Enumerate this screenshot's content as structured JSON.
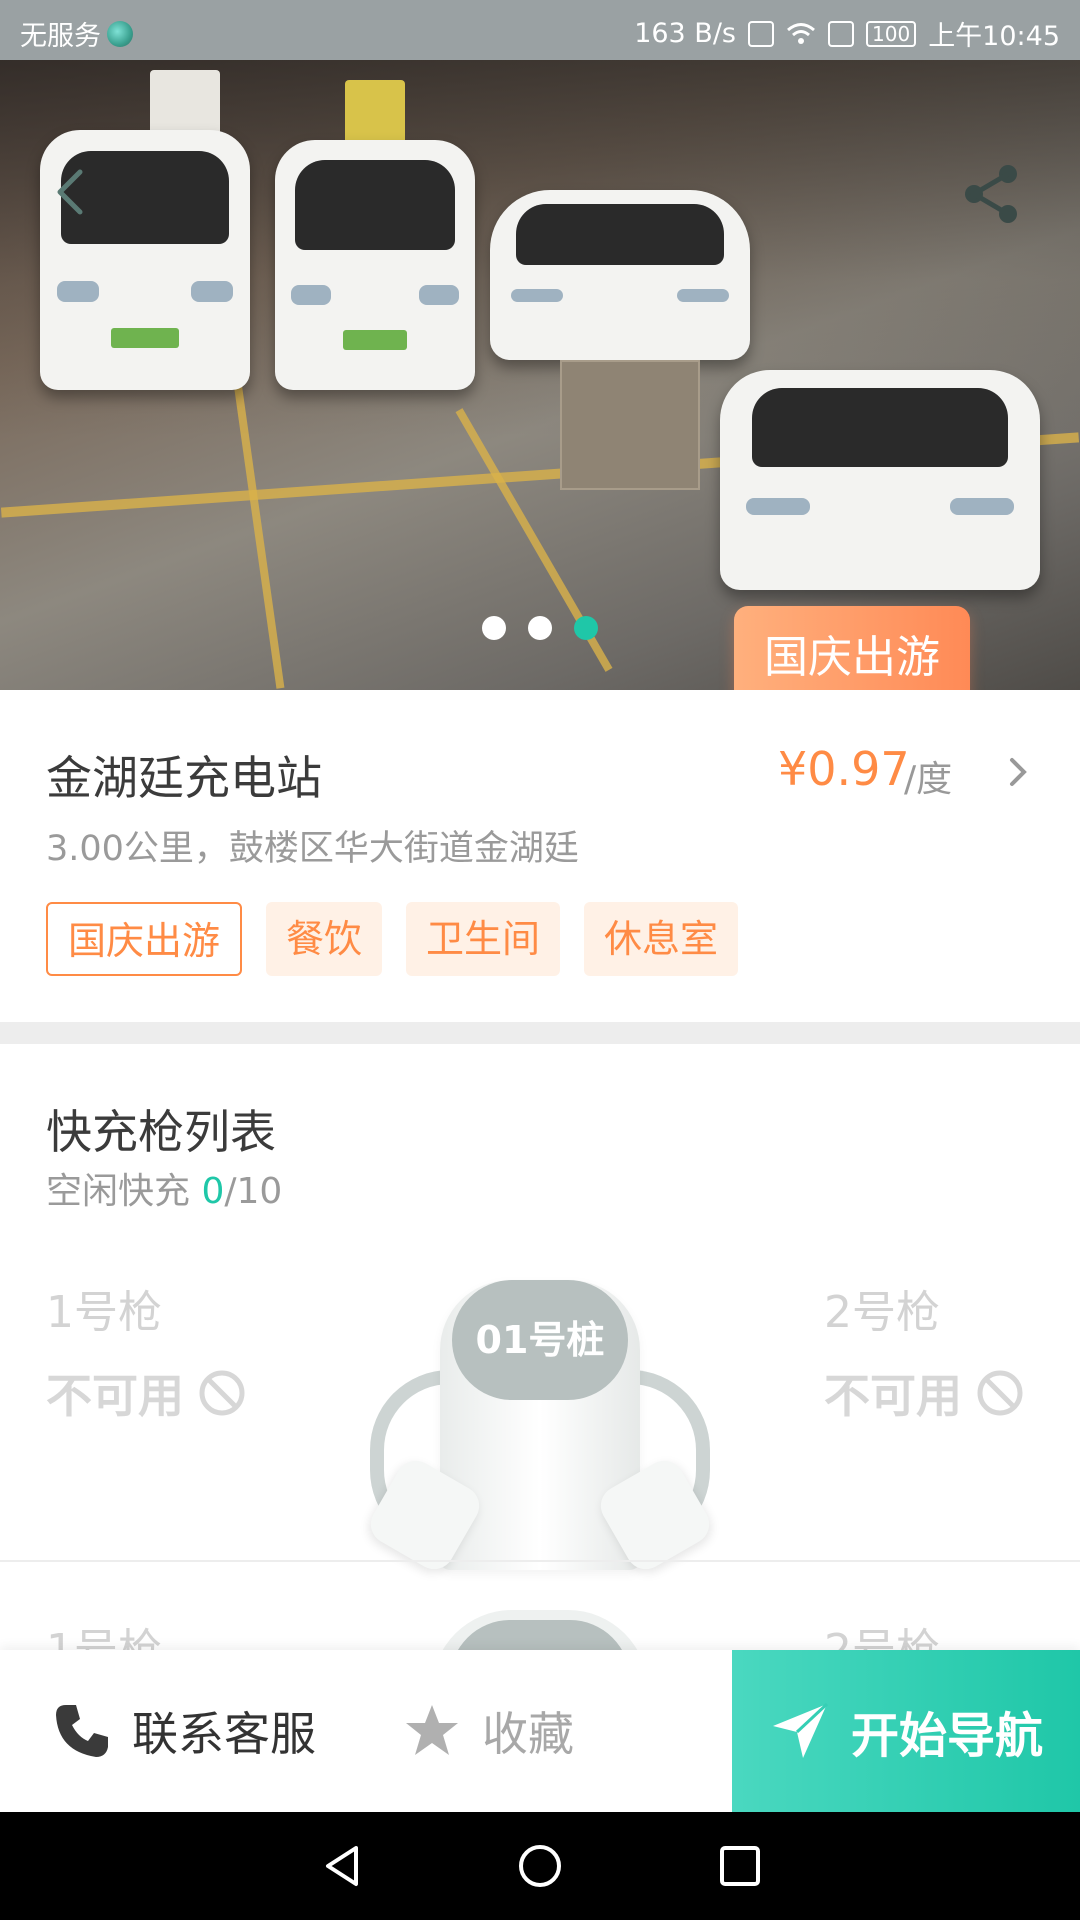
{
  "status_bar": {
    "carrier": "无服务",
    "speed": "163 B/s",
    "battery": "100",
    "time": "上午10:45"
  },
  "hero": {
    "promo_tag": "国庆出游",
    "page_indicator": {
      "count": 3,
      "active": 3
    }
  },
  "station": {
    "name": "金湖廷充电站",
    "price": "¥0.97",
    "price_unit": "/度",
    "address": "3.00公里，鼓楼区华大街道金湖廷",
    "tags": [
      "国庆出游",
      "餐饮",
      "卫生间",
      "休息室"
    ]
  },
  "charger_list": {
    "title": "快充枪列表",
    "idle_label": "空闲快充",
    "idle_count": "0",
    "idle_total": "/10",
    "piles": [
      {
        "name": "01号桩",
        "guns": [
          {
            "label": "1号枪",
            "status": "不可用"
          },
          {
            "label": "2号枪",
            "status": "不可用"
          }
        ]
      },
      {
        "guns": [
          {
            "label": "1号枪"
          },
          {
            "label": "2号枪"
          }
        ]
      }
    ]
  },
  "actions": {
    "service_label": "联系客服",
    "favorite_label": "收藏",
    "navigate_label": "开始导航"
  },
  "colors": {
    "accent_green": "#1fc7a8",
    "accent_orange": "#ff8b45"
  }
}
